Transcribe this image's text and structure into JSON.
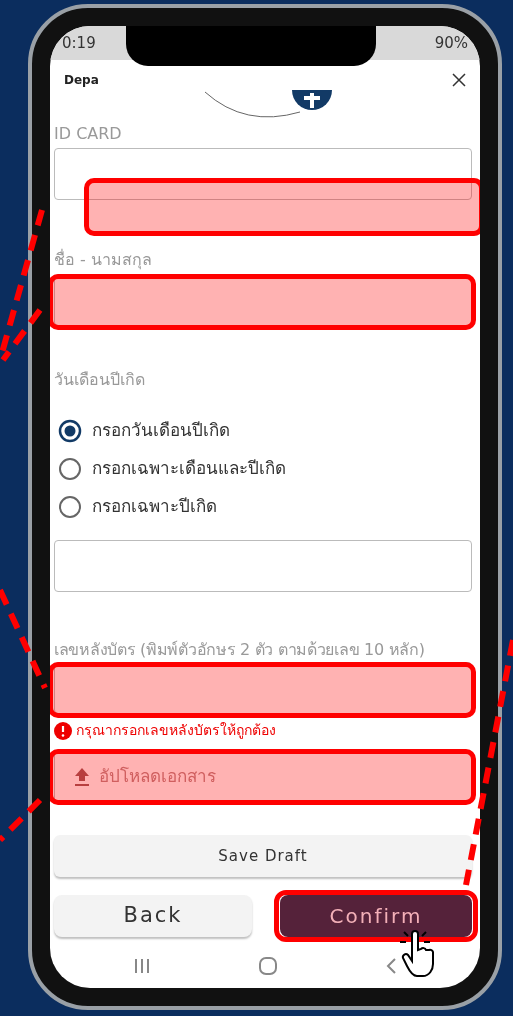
{
  "status_bar": {
    "time": "0:19",
    "battery": "90%"
  },
  "header": {
    "title": "Depa"
  },
  "fields": [
    {
      "kind": "text",
      "label": "ID CARD",
      "highlighted": true
    },
    {
      "kind": "text",
      "label": "ชื่อ - นามสกุล",
      "highlighted": true
    }
  ],
  "birth_date": {
    "label": "วันเดือนปีเกิด",
    "options": [
      {
        "label": "กรอกวันเดือนปีเกิด",
        "selected": true
      },
      {
        "label": "กรอกเฉพาะเดือนและปีเกิด",
        "selected": false
      },
      {
        "label": "กรอกเฉพาะปีเกิด",
        "selected": false
      }
    ]
  },
  "card_back": {
    "label": "เลขหลังบัตร (พิมพ์ตัวอักษร 2 ตัว ตามด้วยเลข 10 หลัก)",
    "highlighted": true,
    "error": "กรุณากรอกเลขหลังบัตรให้ถูกต้อง"
  },
  "upload": {
    "label": "อัปโหลดเอกสาร",
    "highlighted": true
  },
  "buttons": {
    "save_draft": "Save Draft",
    "back": "Back",
    "confirm": "Confirm",
    "confirm_highlighted": true
  }
}
